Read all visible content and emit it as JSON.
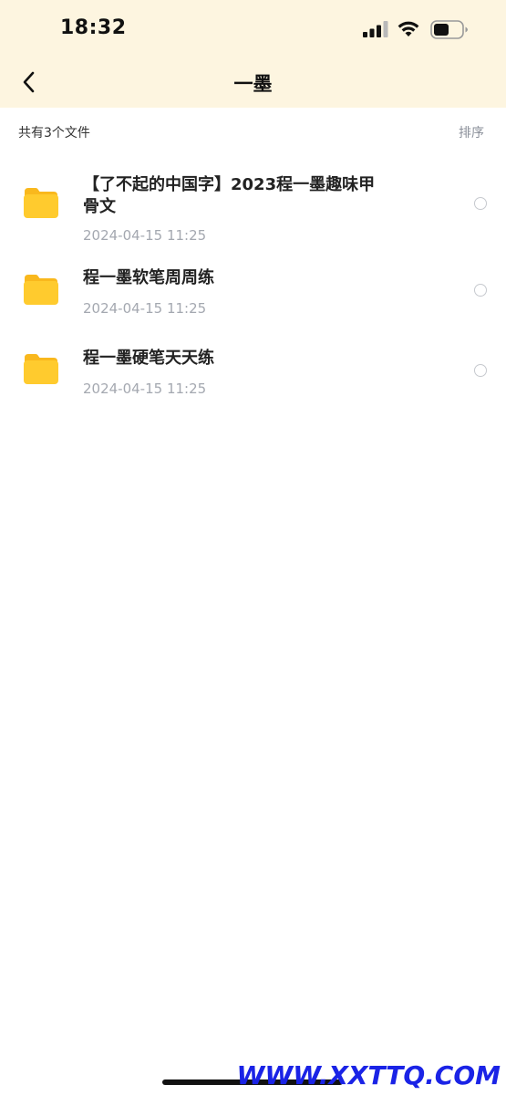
{
  "status_bar": {
    "time": "18:32",
    "icons": [
      "signal-icon",
      "wifi-icon",
      "battery-icon"
    ]
  },
  "nav": {
    "back_icon": "chevron-left-icon",
    "title": "一墨"
  },
  "summary": {
    "count_text": "共有3个文件",
    "sort_label": "排序"
  },
  "files": [
    {
      "icon": "folder-icon",
      "name": "【了不起的中国字】2023程一墨趣味甲骨文",
      "date": "2024-04-15 11:25",
      "selected": false
    },
    {
      "icon": "folder-icon",
      "name": "程一墨软笔周周练",
      "date": "2024-04-15 11:25",
      "selected": false
    },
    {
      "icon": "folder-icon",
      "name": "程一墨硬笔天天练",
      "date": "2024-04-15 11:25",
      "selected": false
    }
  ],
  "watermark": "WWW.XXTTQ.COM",
  "colors": {
    "header_bg": "#fdf5e0",
    "folder": "#ffc928",
    "date_text": "#a4a8b0",
    "watermark": "#1a23e6"
  }
}
